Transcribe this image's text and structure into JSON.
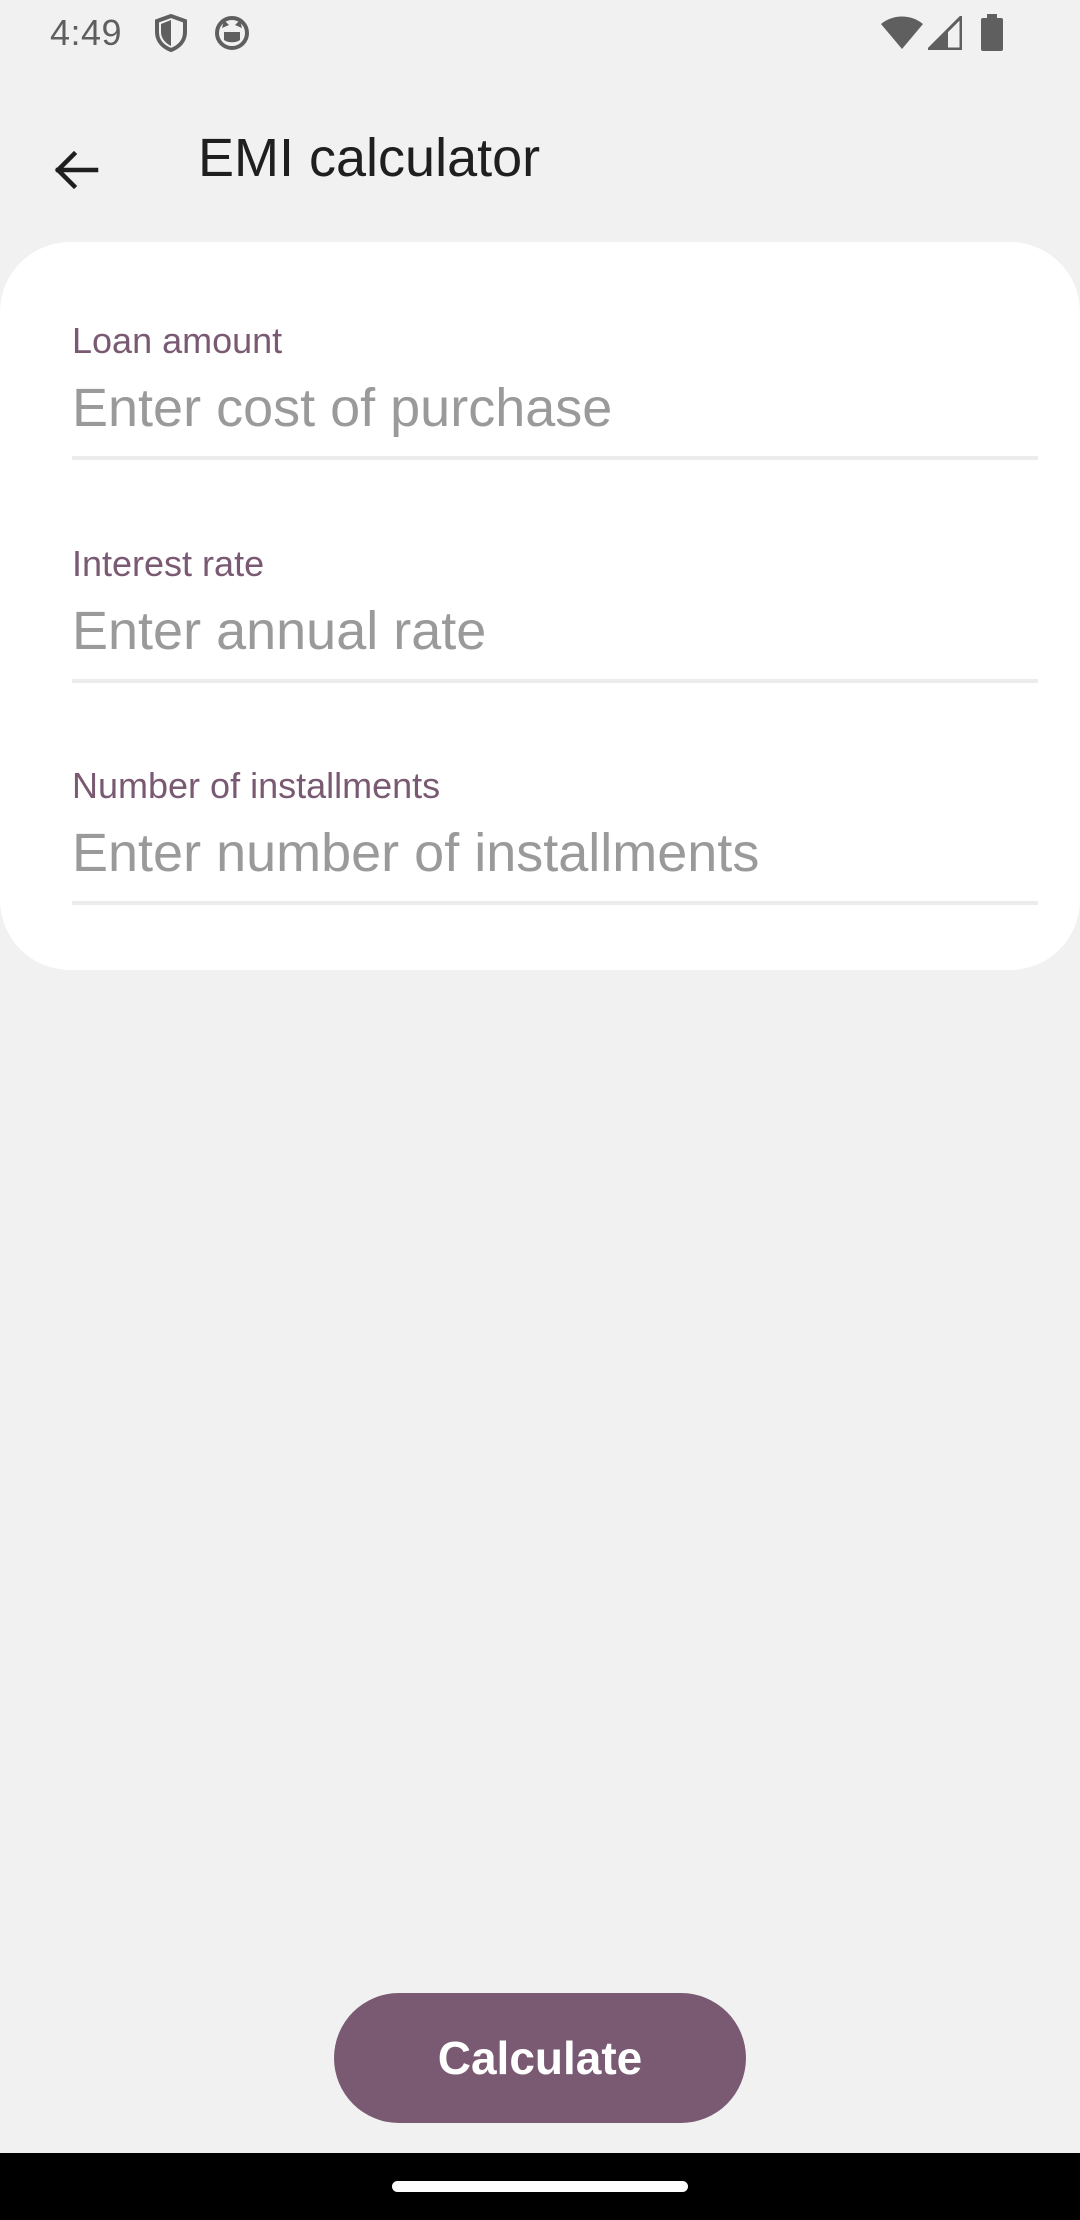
{
  "status_bar": {
    "time": "4:49",
    "icons": [
      "shield-icon",
      "cat-face-icon",
      "wifi-icon",
      "cell-signal-icon",
      "battery-icon"
    ]
  },
  "app_bar": {
    "back_icon": "arrow-left-icon",
    "title": "EMI calculator"
  },
  "form": {
    "loan_amount": {
      "label": "Loan amount",
      "placeholder": "Enter cost of purchase",
      "value": ""
    },
    "interest_rate": {
      "label": "Interest rate",
      "placeholder": "Enter annual rate",
      "value": ""
    },
    "installments": {
      "label": "Number of installments",
      "placeholder": "Enter number of installments",
      "value": ""
    }
  },
  "actions": {
    "calculate_label": "Calculate"
  },
  "colors": {
    "accent": "#7a5a72",
    "background": "#f1f1f1",
    "card": "#ffffff",
    "placeholder": "#9a9a9a"
  }
}
